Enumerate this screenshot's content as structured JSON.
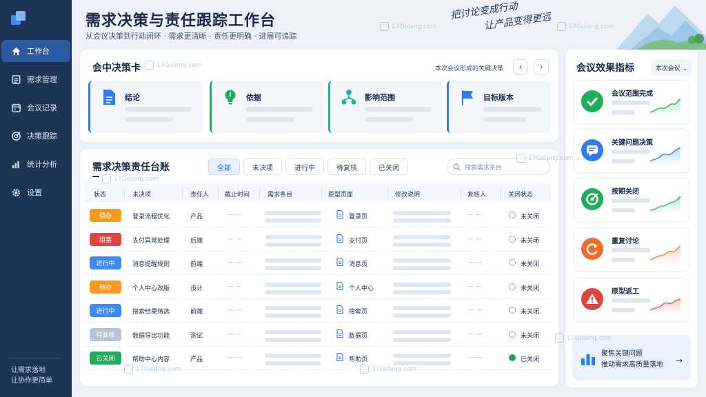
{
  "sidebar": {
    "items": [
      {
        "label": "工作台",
        "icon": "home-icon",
        "active": true
      },
      {
        "label": "需求管理",
        "icon": "list-icon",
        "active": false
      },
      {
        "label": "会议记录",
        "icon": "calendar-icon",
        "active": false
      },
      {
        "label": "决策跟踪",
        "icon": "target-icon",
        "active": false
      },
      {
        "label": "统计分析",
        "icon": "bar-chart-icon",
        "active": false
      },
      {
        "label": "设置",
        "icon": "gear-icon",
        "active": false
      }
    ],
    "footer_line1": "让需求落地",
    "footer_line2": "让协作更简单"
  },
  "header": {
    "title": "需求决策与责任跟踪工作台",
    "subtitle": "从会议决策到行动闭环 · 需求更清晰 · 责任更明确 · 进展可追踪",
    "slogan_line1": "把讨论变成行动",
    "slogan_line2": "让产品变得更远"
  },
  "decisions": {
    "title": "会中决策卡",
    "hint": "本次会议形成的关键决策",
    "prev": "‹",
    "next": "›",
    "cards": [
      {
        "label": "结论",
        "icon": "document-icon",
        "color": "#2f7cf0"
      },
      {
        "label": "依据",
        "icon": "lightbulb-icon",
        "color": "#1fae5b"
      },
      {
        "label": "影响范围",
        "icon": "network-icon",
        "color": "#18b3a3"
      },
      {
        "label": "目标版本",
        "icon": "flag-icon",
        "color": "#2f7cf0"
      }
    ]
  },
  "table": {
    "title": "需求决策责任台账",
    "tabs": [
      "全部",
      "未决项",
      "进行中",
      "待复核",
      "已关闭"
    ],
    "active_tab": 0,
    "search_placeholder": "搜索需求条目",
    "columns": [
      "状态",
      "未决项",
      "责任人",
      "截止时间",
      "需求条目",
      "原型页面",
      "修改说明",
      "复核人",
      "关闭状态"
    ],
    "rows": [
      {
        "status": "待办",
        "status_color": "#f59a23",
        "item": "登录流程优化",
        "owner": "产品",
        "deadline": "— —",
        "page": "登录页",
        "reviewer": "— —",
        "closed": "未关闭",
        "is_closed": false
      },
      {
        "status": "阻塞",
        "status_color": "#e0443e",
        "item": "支付异常处理",
        "owner": "后端",
        "deadline": "— —",
        "page": "支付页",
        "reviewer": "— —",
        "closed": "未关闭",
        "is_closed": false
      },
      {
        "status": "进行中",
        "status_color": "#3d8bf2",
        "item": "消息提醒规则",
        "owner": "前端",
        "deadline": "— —",
        "page": "消息页",
        "reviewer": "— —",
        "closed": "未关闭",
        "is_closed": false
      },
      {
        "status": "待办",
        "status_color": "#f59a23",
        "item": "个人中心改版",
        "owner": "设计",
        "deadline": "— —",
        "page": "个人中心",
        "reviewer": "— —",
        "closed": "未关闭",
        "is_closed": false
      },
      {
        "status": "进行中",
        "status_color": "#3d8bf2",
        "item": "搜索结果筛选",
        "owner": "前端",
        "deadline": "— —",
        "page": "搜索页",
        "reviewer": "— —",
        "closed": "未关闭",
        "is_closed": false
      },
      {
        "status": "待复核",
        "status_color": "#b9c3d1",
        "item": "数据导出功能",
        "owner": "测试",
        "deadline": "— —",
        "page": "数据页",
        "reviewer": "— —",
        "closed": "未关闭",
        "is_closed": false
      },
      {
        "status": "已关闭",
        "status_color": "#1fae5b",
        "item": "帮助中心内容",
        "owner": "产品",
        "deadline": "— —",
        "page": "帮助页",
        "reviewer": "— —",
        "closed": "已关闭",
        "is_closed": true
      }
    ]
  },
  "metrics": {
    "title": "会议效果指标",
    "selector": "本次会议 ⌄",
    "cards": [
      {
        "label": "会议范围完成",
        "icon": "check-icon",
        "color": "#1fae5b",
        "trend_color": "#3cbf6e"
      },
      {
        "label": "关键问题决策",
        "icon": "chat-icon",
        "color": "#2f7cf0",
        "trend_color": "#4a90f0"
      },
      {
        "label": "按期关闭",
        "icon": "target-icon",
        "color": "#1fae5b",
        "trend_color": "#3cbf6e"
      },
      {
        "label": "重复讨论",
        "icon": "refresh-icon",
        "color": "#f26b2a",
        "trend_color": "#f28a5a"
      },
      {
        "label": "原型返工",
        "icon": "warning-icon",
        "color": "#e0443e",
        "trend_color": "#ef6a64"
      }
    ],
    "focus_line1": "聚焦关键问题",
    "focus_line2": "推动需求高质量落地",
    "focus_arrow": "→"
  },
  "watermark": "17Golang.com"
}
